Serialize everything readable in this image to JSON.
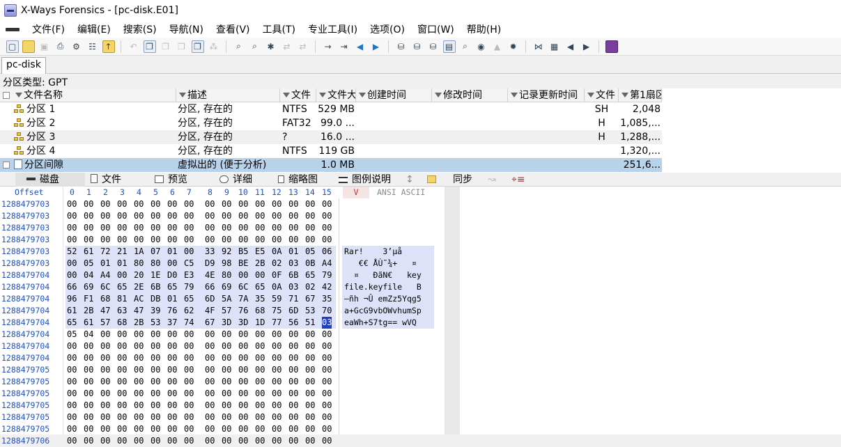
{
  "window": {
    "title": "X-Ways Forensics - [pc-disk.E01]"
  },
  "menu": [
    "文件(F)",
    "编辑(E)",
    "搜索(S)",
    "导航(N)",
    "查看(V)",
    "工具(T)",
    "专业工具(I)",
    "选项(O)",
    "窗口(W)",
    "帮助(H)"
  ],
  "tab": {
    "label": "pc-disk"
  },
  "partition_type": "分区类型: GPT",
  "table": {
    "headers": [
      "文件名称",
      "描述",
      "文件",
      "文件大",
      "创建时间",
      "修改时间",
      "记录更新时间",
      "文件",
      "第1扇区"
    ],
    "rows": [
      {
        "name": "分区 1",
        "desc": "分区, 存在的",
        "fs": "NTFS",
        "size": "529 MB",
        "attr": "SH",
        "sector": "2,048"
      },
      {
        "name": "分区 2",
        "desc": "分区, 存在的",
        "fs": "FAT32",
        "size": "99.0 ...",
        "attr": "H",
        "sector": "1,085,..."
      },
      {
        "name": "分区 3",
        "desc": "分区, 存在的",
        "fs": "?",
        "size": "16.0 ...",
        "attr": "H",
        "sector": "1,288,..."
      },
      {
        "name": "分区 4",
        "desc": "分区, 存在的",
        "fs": "NTFS",
        "size": "119 GB",
        "attr": "",
        "sector": "1,320,..."
      },
      {
        "name": "分区间隙",
        "desc": "虚拟出的 (便于分析)",
        "fs": "",
        "size": "1.0 MB",
        "attr": "",
        "sector": "251,6..."
      }
    ]
  },
  "view_tabs": [
    "磁盘",
    "文件",
    "预览",
    "详细",
    "缩略图",
    "图例说明",
    "同步"
  ],
  "hex": {
    "offset_label": "Offset",
    "columns": [
      "0",
      "1",
      "2",
      "3",
      "4",
      "5",
      "6",
      "7",
      "8",
      "9",
      "10",
      "11",
      "12",
      "13",
      "14",
      "15"
    ],
    "ansi_label": "ANSI ASCII",
    "v_label": "V",
    "rows": [
      {
        "off": "1288479703",
        "bytes": [
          "00",
          "00",
          "00",
          "00",
          "00",
          "00",
          "00",
          "00",
          "00",
          "00",
          "00",
          "00",
          "00",
          "00",
          "00",
          "00"
        ],
        "ascii": ""
      },
      {
        "off": "1288479703",
        "bytes": [
          "00",
          "00",
          "00",
          "00",
          "00",
          "00",
          "00",
          "00",
          "00",
          "00",
          "00",
          "00",
          "00",
          "00",
          "00",
          "00"
        ],
        "ascii": ""
      },
      {
        "off": "1288479703",
        "bytes": [
          "00",
          "00",
          "00",
          "00",
          "00",
          "00",
          "00",
          "00",
          "00",
          "00",
          "00",
          "00",
          "00",
          "00",
          "00",
          "00"
        ],
        "ascii": ""
      },
      {
        "off": "1288479703",
        "bytes": [
          "00",
          "00",
          "00",
          "00",
          "00",
          "00",
          "00",
          "00",
          "00",
          "00",
          "00",
          "00",
          "00",
          "00",
          "00",
          "00"
        ],
        "ascii": ""
      },
      {
        "off": "1288479703",
        "bytes": [
          "52",
          "61",
          "72",
          "21",
          "1A",
          "07",
          "01",
          "00",
          "33",
          "92",
          "B5",
          "E5",
          "0A",
          "01",
          "05",
          "06"
        ],
        "ascii": "Rar!    3’µå",
        "hl": true
      },
      {
        "off": "1288479703",
        "bytes": [
          "00",
          "05",
          "01",
          "01",
          "80",
          "80",
          "00",
          "C5",
          "D9",
          "98",
          "BE",
          "2B",
          "02",
          "03",
          "0B",
          "A4"
        ],
        "ascii": "   €€ ÅÙ˜¾+   ¤",
        "hl": true
      },
      {
        "off": "1288479704",
        "bytes": [
          "00",
          "04",
          "A4",
          "00",
          "20",
          "1E",
          "D0",
          "E3",
          "4E",
          "80",
          "00",
          "00",
          "0F",
          "6B",
          "65",
          "79"
        ],
        "ascii": "  ¤   ÐãN€   key",
        "hl": true
      },
      {
        "off": "1288479704",
        "bytes": [
          "66",
          "69",
          "6C",
          "65",
          "2E",
          "6B",
          "65",
          "79",
          "66",
          "69",
          "6C",
          "65",
          "0A",
          "03",
          "02",
          "42"
        ],
        "ascii": "file.keyfile   B",
        "hl": true
      },
      {
        "off": "1288479704",
        "bytes": [
          "96",
          "F1",
          "68",
          "81",
          "AC",
          "DB",
          "01",
          "65",
          "6D",
          "5A",
          "7A",
          "35",
          "59",
          "71",
          "67",
          "35"
        ],
        "ascii": "–ñh ¬Û emZz5Yqg5",
        "hl": true
      },
      {
        "off": "1288479704",
        "bytes": [
          "61",
          "2B",
          "47",
          "63",
          "47",
          "39",
          "76",
          "62",
          "4F",
          "57",
          "76",
          "68",
          "75",
          "6D",
          "53",
          "70"
        ],
        "ascii": "a+GcG9vbOWvhumSp",
        "hl": true
      },
      {
        "off": "1288479704",
        "bytes": [
          "65",
          "61",
          "57",
          "68",
          "2B",
          "53",
          "37",
          "74",
          "67",
          "3D",
          "3D",
          "1D",
          "77",
          "56",
          "51",
          "03"
        ],
        "ascii": "eaWh+S7tg== wVQ",
        "hl": true,
        "cursor": 15
      },
      {
        "off": "1288479704",
        "bytes": [
          "05",
          "04",
          "00",
          "00",
          "00",
          "00",
          "00",
          "00",
          "00",
          "00",
          "00",
          "00",
          "00",
          "00",
          "00",
          "00"
        ],
        "ascii": ""
      },
      {
        "off": "1288479704",
        "bytes": [
          "00",
          "00",
          "00",
          "00",
          "00",
          "00",
          "00",
          "00",
          "00",
          "00",
          "00",
          "00",
          "00",
          "00",
          "00",
          "00"
        ],
        "ascii": ""
      },
      {
        "off": "1288479704",
        "bytes": [
          "00",
          "00",
          "00",
          "00",
          "00",
          "00",
          "00",
          "00",
          "00",
          "00",
          "00",
          "00",
          "00",
          "00",
          "00",
          "00"
        ],
        "ascii": ""
      },
      {
        "off": "1288479705",
        "bytes": [
          "00",
          "00",
          "00",
          "00",
          "00",
          "00",
          "00",
          "00",
          "00",
          "00",
          "00",
          "00",
          "00",
          "00",
          "00",
          "00"
        ],
        "ascii": ""
      },
      {
        "off": "1288479705",
        "bytes": [
          "00",
          "00",
          "00",
          "00",
          "00",
          "00",
          "00",
          "00",
          "00",
          "00",
          "00",
          "00",
          "00",
          "00",
          "00",
          "00"
        ],
        "ascii": ""
      },
      {
        "off": "1288479705",
        "bytes": [
          "00",
          "00",
          "00",
          "00",
          "00",
          "00",
          "00",
          "00",
          "00",
          "00",
          "00",
          "00",
          "00",
          "00",
          "00",
          "00"
        ],
        "ascii": ""
      },
      {
        "off": "1288479705",
        "bytes": [
          "00",
          "00",
          "00",
          "00",
          "00",
          "00",
          "00",
          "00",
          "00",
          "00",
          "00",
          "00",
          "00",
          "00",
          "00",
          "00"
        ],
        "ascii": ""
      },
      {
        "off": "1288479705",
        "bytes": [
          "00",
          "00",
          "00",
          "00",
          "00",
          "00",
          "00",
          "00",
          "00",
          "00",
          "00",
          "00",
          "00",
          "00",
          "00",
          "00"
        ],
        "ascii": ""
      },
      {
        "off": "1288479705",
        "bytes": [
          "00",
          "00",
          "00",
          "00",
          "00",
          "00",
          "00",
          "00",
          "00",
          "00",
          "00",
          "00",
          "00",
          "00",
          "00",
          "00"
        ],
        "ascii": ""
      },
      {
        "off": "1288479706",
        "bytes": [
          "00",
          "00",
          "00",
          "00",
          "00",
          "00",
          "00",
          "00",
          "00",
          "00",
          "00",
          "00",
          "00",
          "00",
          "00",
          "00"
        ],
        "ascii": ""
      }
    ]
  },
  "colors": {
    "selection": "#b8d2ea",
    "hex_highlight": "#dde2f8",
    "offset_blue": "#2050c0",
    "cursor": "#1e3ec8"
  }
}
